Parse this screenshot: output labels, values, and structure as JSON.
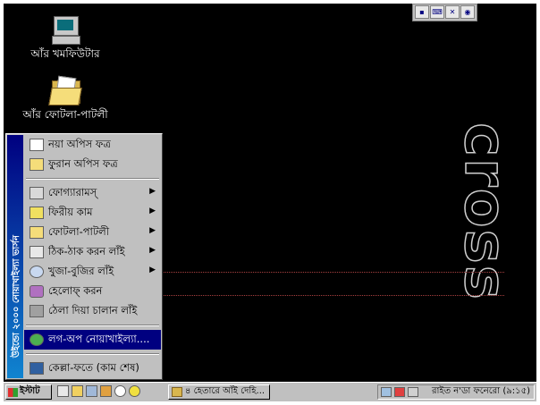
{
  "desktop": {
    "icons": [
      {
        "label": "আঁর খমফিউটার",
        "icon": "computer-icon"
      },
      {
        "label": "আঁর ফোটলা-পাটলী",
        "icon": "folder-icon"
      }
    ],
    "brand_text": "cross",
    "top_tray_icons": [
      "flag-icon",
      "keyboard-icon",
      "tools-icon",
      "network-icon"
    ]
  },
  "start_menu": {
    "banner": "উইন্ডো ২০০০ নোয়াখাইল্যা ভার্সন",
    "items": [
      {
        "label": "নয়া অপিস ফত্র",
        "icon": "new-document-icon",
        "submenu": false
      },
      {
        "label": "ফুরান অপিস ফত্র",
        "icon": "open-folder-icon",
        "submenu": false
      },
      {
        "label": "ফোগ্যারামস্",
        "icon": "programs-icon",
        "submenu": true
      },
      {
        "label": "ফিরীয় কাম",
        "icon": "favorites-icon",
        "submenu": true
      },
      {
        "label": "ফোটলা-পাটলী",
        "icon": "documents-folder-icon",
        "submenu": true
      },
      {
        "label": "ঠিক-ঠাক করন লাঁই",
        "icon": "settings-icon",
        "submenu": true
      },
      {
        "label": "খুজা-বুজির লাঁই",
        "icon": "search-icon",
        "submenu": true
      },
      {
        "label": "হেলোফ্ করন",
        "icon": "help-icon",
        "submenu": false
      },
      {
        "label": "ঠেলা দিয়া চালান লাঁই",
        "icon": "run-icon",
        "submenu": false
      },
      {
        "label": "লগ-অপ নোয়াখাইল্যা....",
        "icon": "log-off-icon",
        "submenu": false,
        "selected": true
      },
      {
        "label": "কেল্লা-ফতে (কাম শেষ)",
        "icon": "shut-down-icon",
        "submenu": false
      }
    ]
  },
  "taskbar": {
    "start_label": "ইস্টাট",
    "quick_launch": [
      "desktop-icon",
      "pen-icon",
      "window-icon",
      "grid-icon",
      "help-circle-icon",
      "radiation-icon"
    ],
    "task_label": "৪ হেতারে আঁই দেহি...",
    "tray_text": "রাইত ন'ডা ফনেরো (৯:১৫)"
  }
}
